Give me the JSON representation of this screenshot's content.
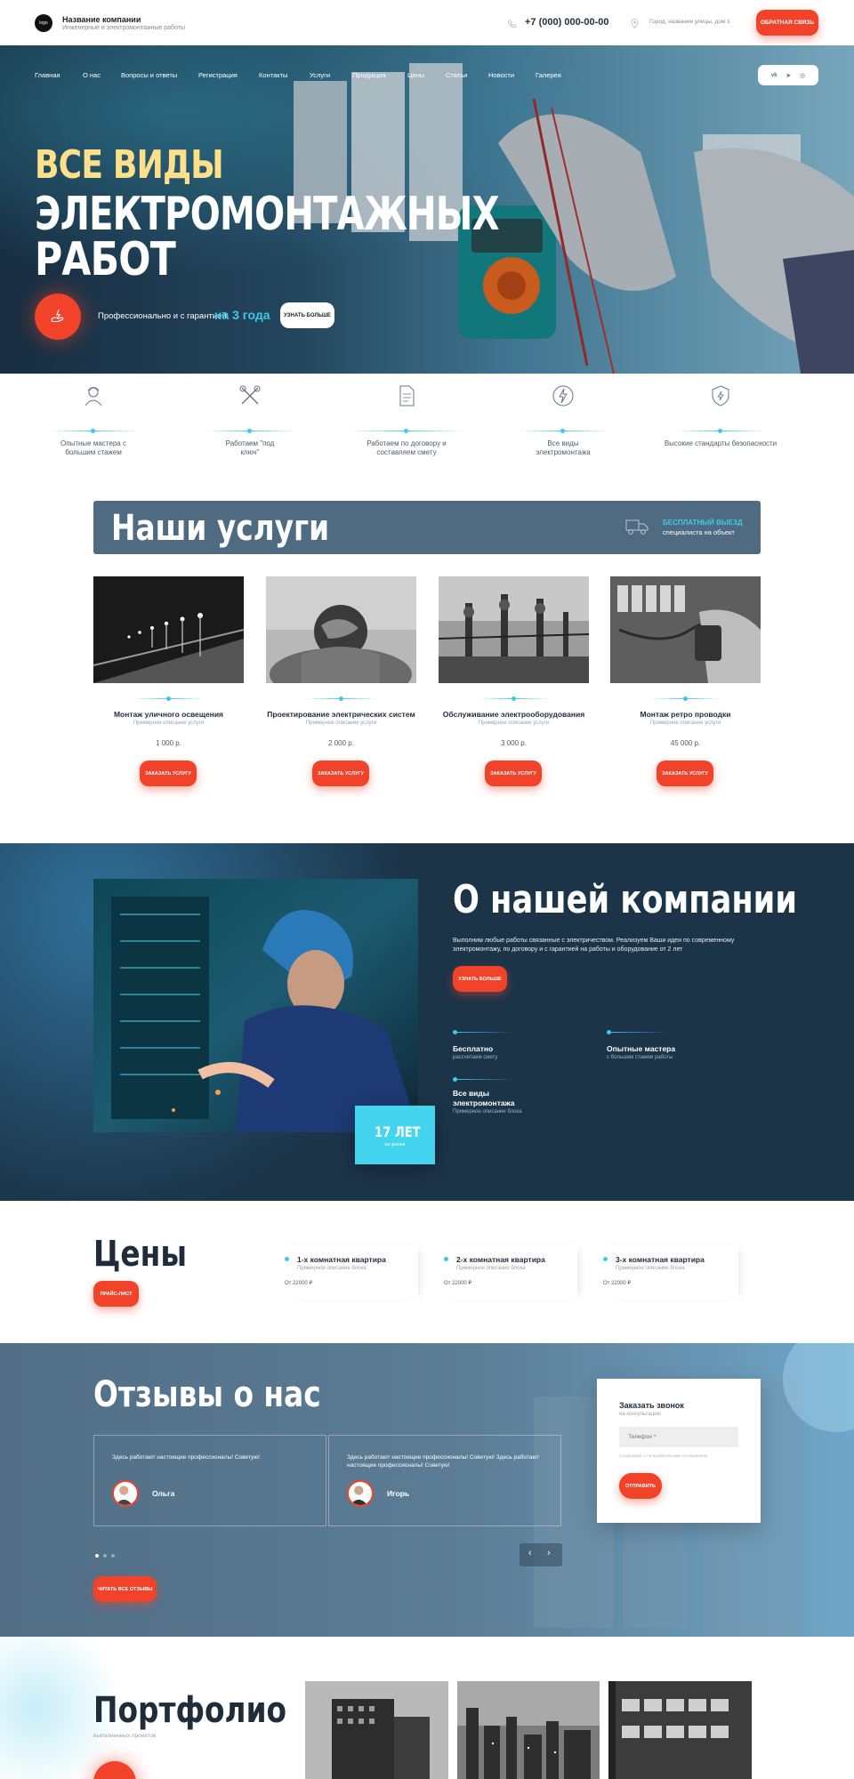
{
  "header": {
    "company_name": "Название компании",
    "company_sub": "Инженерные и электромонтажные работы",
    "logo_text": "logo",
    "phone": "+7 (000) 000-00-00",
    "address": "Город, название улицы, дом 1",
    "callback_btn": "ОБРАТНАЯ СВЯЗЬ"
  },
  "nav": {
    "items": [
      "Главная",
      "О нас",
      "Вопросы и ответы",
      "Регистрация",
      "Контакты",
      "Услуги",
      "Продукция",
      "Цены",
      "Статьи",
      "Новости",
      "Галерея"
    ],
    "social": [
      "vk-icon",
      "telegram-icon",
      "whatsapp-icon"
    ]
  },
  "hero": {
    "line1": "ВСЕ ВИДЫ",
    "line2": "ЭЛЕКТРОМОНТАЖНЫХ",
    "line3": "РАБОТ",
    "tagline": "Профессионально и с гарантией",
    "guarantee": "на 3 года",
    "more_btn": "УЗНАТЬ БОЛЬШЕ"
  },
  "features": [
    {
      "icon": "master-icon",
      "text": "Опытные мастера с большим стажем"
    },
    {
      "icon": "tools-icon",
      "text": "Работаем \"под ключ\""
    },
    {
      "icon": "document-icon",
      "text": "Работаем по договору и составляем смету"
    },
    {
      "icon": "lightning-icon",
      "text": "Все виды электромонтажа"
    },
    {
      "icon": "shield-icon",
      "text": "Высокие стандарты безопасности"
    }
  ],
  "services": {
    "title": "Наши услуги",
    "free_title": "БЕСПЛАТНЫЙ ВЫЕЗД",
    "free_sub": "специалиста на объект",
    "items": [
      {
        "name": "Монтаж уличного освещения",
        "desc": "Примерное описание услуги",
        "price": "1 000 р.",
        "btn": "ЗАКАЗАТЬ УСЛУГУ"
      },
      {
        "name": "Проектирование электрических систем",
        "desc": "Примерное описание услуги",
        "price": "2 000 р.",
        "btn": "ЗАКАЗАТЬ УСЛУГУ"
      },
      {
        "name": "Обслуживание электрооборудования",
        "desc": "Примерное описание услуги",
        "price": "3 000 р.",
        "btn": "ЗАКАЗАТЬ УСЛУГУ"
      },
      {
        "name": "Монтаж ретро проводки",
        "desc": "Примерное описание услуги",
        "price": "45 000 р.",
        "btn": "ЗАКАЗАТЬ УСЛУГУ"
      }
    ]
  },
  "about": {
    "title": "О нашей компании",
    "text": "Выполним любые работы связанные с электричеством. Реализуем Ваши идеи по современному электромонтажу, по договору и с гарантией на работы и оборудование от 2 лет",
    "btn": "УЗНАТЬ БОЛЬШЕ",
    "badge_big": "17 ЛЕТ",
    "badge_small": "на рынке",
    "points": [
      {
        "title": "Бесплатно",
        "sub": "рассчитаем смету"
      },
      {
        "title": "Опытные мастера",
        "sub": "с большим стажем работы"
      },
      {
        "title": "Все виды электромонтажа",
        "sub": "Примерное описание блока"
      }
    ]
  },
  "prices": {
    "title": "Цены",
    "btn": "ПРАЙС-ЛИСТ",
    "items": [
      {
        "title": "1-х комнатная квартира",
        "desc": "Примерное описание блока",
        "price": "От 22000 ₽"
      },
      {
        "title": "2-х комнатная квартира",
        "desc": "Примерное описание блока",
        "price": "От 22000 ₽"
      },
      {
        "title": "3-х комнатная квартира",
        "desc": "Примерное описание блока",
        "price": "От 22000 ₽"
      }
    ]
  },
  "reviews": {
    "title": "Отзывы о нас",
    "items": [
      {
        "text": "Здесь работают настоящие профессионалы! Советую!",
        "name": "Ольга"
      },
      {
        "text": "Здесь работают настоящие профессионалы! Советую! Здесь работают настоящие профессионалы! Советую!",
        "name": "Игорь"
      }
    ],
    "btn": "ЧИТАТЬ ВСЕ ОТЗЫВЫ"
  },
  "callback_form": {
    "title": "Заказать звонок",
    "sub": "на консультацию",
    "placeholder": "Телефон *",
    "consent": "Соглашаюсь с пользовательским соглашением",
    "btn": "ОТПРАВИТЬ"
  },
  "portfolio": {
    "title": "Портфолио",
    "sub": "выполненных проектов"
  },
  "colors": {
    "accent": "#f0432a",
    "navy": "#1e3a52",
    "cyan": "#43c7e6",
    "gold": "#ffe08a"
  }
}
